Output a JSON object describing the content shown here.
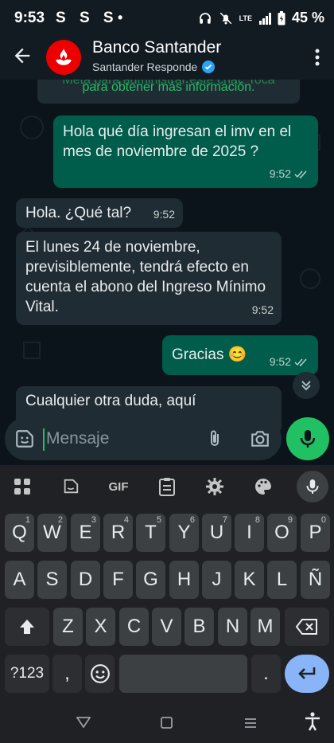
{
  "status": {
    "time": "9:53",
    "carrier_icons": "S S S",
    "dot": "•",
    "network": "LTE",
    "battery": "45 %"
  },
  "header": {
    "title": "Banco Santander",
    "subtitle": "Santander Responde"
  },
  "system_message": {
    "line1": "Meta para administrar este chat. Toca",
    "line2": "para obtener más información."
  },
  "messages": [
    {
      "dir": "out",
      "text": "Hola qué día ingresan el imv en el mes de noviembre de 2025 ?",
      "time": "9:52"
    },
    {
      "dir": "in",
      "text": "Hola. ¿Qué tal?",
      "time": "9:52"
    },
    {
      "dir": "in",
      "text": "El lunes 24 de noviembre, previsiblemente, tendrá efecto en cuenta el abono del Ingreso Mínimo Vital.",
      "time": "9:52"
    },
    {
      "dir": "out",
      "text": "Gracias 😊",
      "time": "9:52"
    },
    {
      "dir": "in",
      "text": "Cualquier otra duda, aquí",
      "time": ""
    }
  ],
  "composer": {
    "placeholder": "Mensaje"
  },
  "keyboard": {
    "toolbar_gif": "GIF",
    "row1": [
      "Q",
      "W",
      "E",
      "R",
      "T",
      "Y",
      "U",
      "I",
      "O",
      "P"
    ],
    "row1_hints": [
      "1",
      "2",
      "3",
      "4",
      "5",
      "6",
      "7",
      "8",
      "9",
      "0"
    ],
    "row2": [
      "A",
      "S",
      "D",
      "F",
      "G",
      "H",
      "J",
      "K",
      "L",
      "Ñ"
    ],
    "row3": [
      "Z",
      "X",
      "C",
      "V",
      "B",
      "N",
      "M"
    ],
    "symbols_label": "?123",
    "comma": ",",
    "period": "."
  }
}
